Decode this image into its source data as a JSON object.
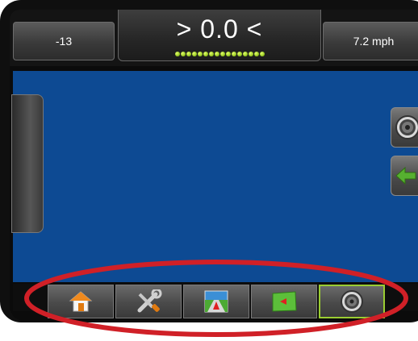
{
  "topbar": {
    "left_value": "-13",
    "center_value": "> 0.0 <",
    "right_value": "7.2 mph",
    "lightbar_led_count": 16
  },
  "side_buttons": {
    "upper_icon": "speaker-icon",
    "lower_icon": "back-arrow-icon"
  },
  "tabs": [
    {
      "id": "home",
      "icon": "home-icon"
    },
    {
      "id": "tools",
      "icon": "tools-icon"
    },
    {
      "id": "guidance",
      "icon": "guidance-view-icon"
    },
    {
      "id": "map",
      "icon": "map-icon"
    },
    {
      "id": "audio",
      "icon": "speaker-icon",
      "selected": true
    }
  ],
  "colors": {
    "map_background": "#0d4a93",
    "led_green": "#8ec11a",
    "selected_tab_border": "#9acd32",
    "highlight_ellipse": "#d02027",
    "back_arrow": "#56b030"
  }
}
